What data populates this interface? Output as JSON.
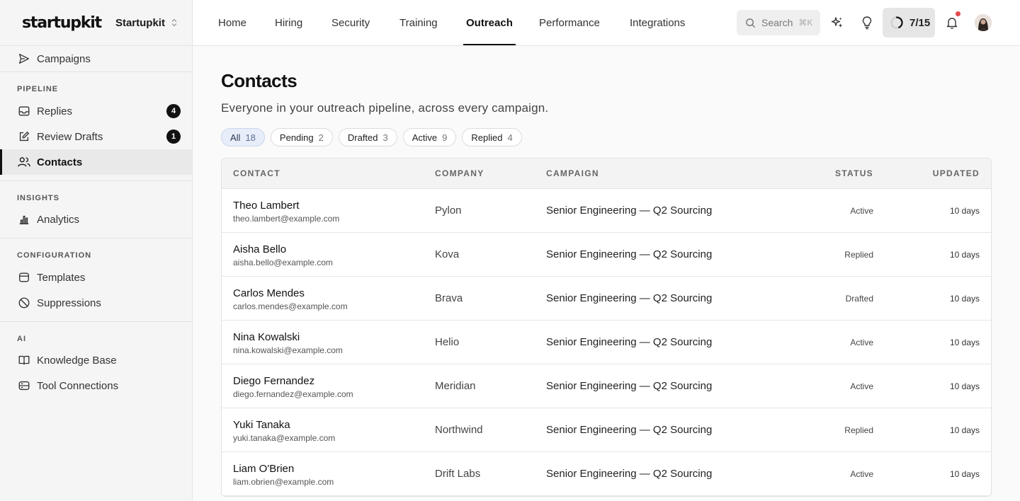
{
  "brand": {
    "logo": "startupkit",
    "workspace": "Startupkit"
  },
  "sidebar": {
    "top_items": [
      {
        "label": "Campaigns",
        "icon": "send-icon"
      }
    ],
    "sections": [
      {
        "label": "PIPELINE",
        "items": [
          {
            "label": "Replies",
            "icon": "inbox-icon",
            "badge": "4"
          },
          {
            "label": "Review Drafts",
            "icon": "pencil-square-icon",
            "badge": "1"
          },
          {
            "label": "Contacts",
            "icon": "users-icon",
            "active": true
          }
        ]
      },
      {
        "label": "INSIGHTS",
        "items": [
          {
            "label": "Analytics",
            "icon": "bar-chart-icon"
          }
        ]
      },
      {
        "label": "CONFIGURATION",
        "items": [
          {
            "label": "Templates",
            "icon": "template-icon"
          },
          {
            "label": "Suppressions",
            "icon": "ban-icon"
          }
        ]
      },
      {
        "label": "AI",
        "items": [
          {
            "label": "Knowledge Base",
            "icon": "book-icon"
          },
          {
            "label": "Tool Connections",
            "icon": "server-icon"
          }
        ]
      }
    ]
  },
  "header": {
    "tabs": [
      "Home",
      "Hiring",
      "Security",
      "Training",
      "Outreach",
      "Performance",
      "Integrations"
    ],
    "active_tab": "Outreach",
    "search": {
      "placeholder": "Search",
      "shortcut": "⌘K"
    },
    "progress": "7/15"
  },
  "page": {
    "title": "Contacts",
    "subtitle": "Everyone in your outreach pipeline, across every campaign.",
    "filters": [
      {
        "label": "All",
        "count": "18",
        "active": true
      },
      {
        "label": "Pending",
        "count": "2"
      },
      {
        "label": "Drafted",
        "count": "3"
      },
      {
        "label": "Active",
        "count": "9"
      },
      {
        "label": "Replied",
        "count": "4"
      }
    ]
  },
  "table": {
    "columns": {
      "contact": "CONTACT",
      "company": "COMPANY",
      "campaign": "CAMPAIGN",
      "status": "STATUS",
      "updated": "UPDATED"
    },
    "rows": [
      {
        "name": "Theo Lambert",
        "email": "theo.lambert@example.com",
        "company": "Pylon",
        "campaign": "Senior Engineering — Q2 Sourcing",
        "status": "Active",
        "updated": "10 days"
      },
      {
        "name": "Aisha Bello",
        "email": "aisha.bello@example.com",
        "company": "Kova",
        "campaign": "Senior Engineering — Q2 Sourcing",
        "status": "Replied",
        "updated": "10 days"
      },
      {
        "name": "Carlos Mendes",
        "email": "carlos.mendes@example.com",
        "company": "Brava",
        "campaign": "Senior Engineering — Q2 Sourcing",
        "status": "Drafted",
        "updated": "10 days"
      },
      {
        "name": "Nina Kowalski",
        "email": "nina.kowalski@example.com",
        "company": "Helio",
        "campaign": "Senior Engineering — Q2 Sourcing",
        "status": "Active",
        "updated": "10 days"
      },
      {
        "name": "Diego Fernandez",
        "email": "diego.fernandez@example.com",
        "company": "Meridian",
        "campaign": "Senior Engineering — Q2 Sourcing",
        "status": "Active",
        "updated": "10 days"
      },
      {
        "name": "Yuki Tanaka",
        "email": "yuki.tanaka@example.com",
        "company": "Northwind",
        "campaign": "Senior Engineering — Q2 Sourcing",
        "status": "Replied",
        "updated": "10 days"
      },
      {
        "name": "Liam O'Brien",
        "email": "liam.obrien@example.com",
        "company": "Drift Labs",
        "campaign": "Senior Engineering — Q2 Sourcing",
        "status": "Active",
        "updated": "10 days"
      }
    ]
  }
}
